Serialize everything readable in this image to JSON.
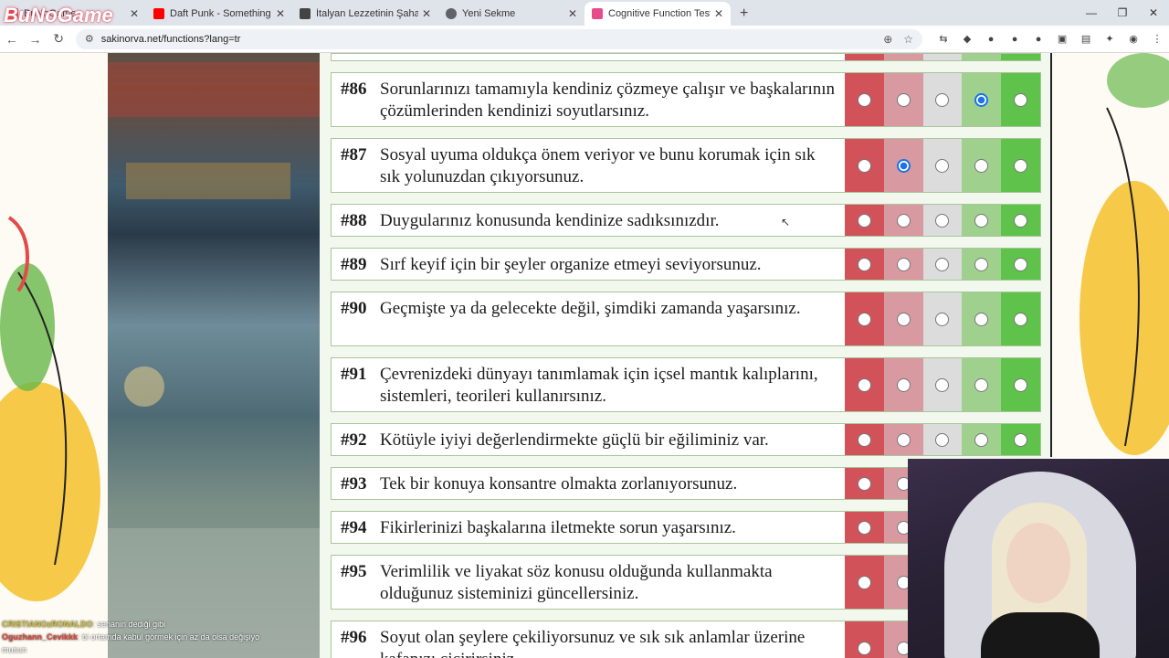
{
  "watermark": "BuNoGame",
  "tabs": [
    {
      "label": "BuNoGame",
      "color": "#e5484d"
    },
    {
      "label": "Daft Punk - Something About U",
      "color": "#ff0000"
    },
    {
      "label": "İtalyan Lezzetinin Şahanesi Tira",
      "color": "#444444"
    },
    {
      "label": "Yeni Sekme",
      "color": "#5f6368"
    },
    {
      "label": "Cognitive Function Test (Grant/",
      "color": "#e94b8a"
    }
  ],
  "address": {
    "url": "sakinorva.net/functions?lang=tr"
  },
  "questions": [
    {
      "num": "#86",
      "text": "Sorunlarınızı tamamıyla kendiniz çözmeye çalışır ve başkalarının çözümlerinden kendinizi soyutlarsınız.",
      "selected": 4
    },
    {
      "num": "#87",
      "text": "Sosyal uyuma oldukça önem veriyor ve bunu korumak için sık sık yolunuzdan çıkıyorsunuz.",
      "selected": 2
    },
    {
      "num": "#88",
      "text": "Duygularınız konusunda kendinize sadıksınızdır.",
      "selected": 0
    },
    {
      "num": "#89",
      "text": "Sırf keyif için bir şeyler organize etmeyi seviyorsunuz.",
      "selected": 0
    },
    {
      "num": "#90",
      "text": "Geçmişte ya da gelecekte değil, şimdiki zamanda yaşarsınız.",
      "selected": 0
    },
    {
      "num": "#91",
      "text": "Çevrenizdeki dünyayı tanımlamak için içsel mantık kalıplarını, sistemleri, teorileri kullanırsınız.",
      "selected": 0
    },
    {
      "num": "#92",
      "text": "Kötüyle iyiyi değerlendirmekte güçlü bir eğiliminiz var.",
      "selected": 0
    },
    {
      "num": "#93",
      "text": "Tek bir konuya konsantre olmakta zorlanıyorsunuz.",
      "selected": 0
    },
    {
      "num": "#94",
      "text": "Fikirlerinizi başkalarına iletmekte sorun yaşarsınız.",
      "selected": 0
    },
    {
      "num": "#95",
      "text": "Verimlilik ve liyakat söz konusu olduğunda kullanmakta olduğunuz sisteminizi güncellersiniz.",
      "selected": 0
    },
    {
      "num": "#96",
      "text": "Soyut olan şeylere çekiliyorsunuz ve sık sık anlamlar üzerine kafanızı çiçirirsiniz.",
      "selected": 0
    }
  ],
  "chat": [
    {
      "user": "CRISTIANOzRONALDO",
      "message": "senanin dediği gibi"
    },
    {
      "user": "Oguzhann_Cevikkk",
      "message": "bi ortamda kabul görmek için az da olsa değişiyo musun"
    }
  ]
}
